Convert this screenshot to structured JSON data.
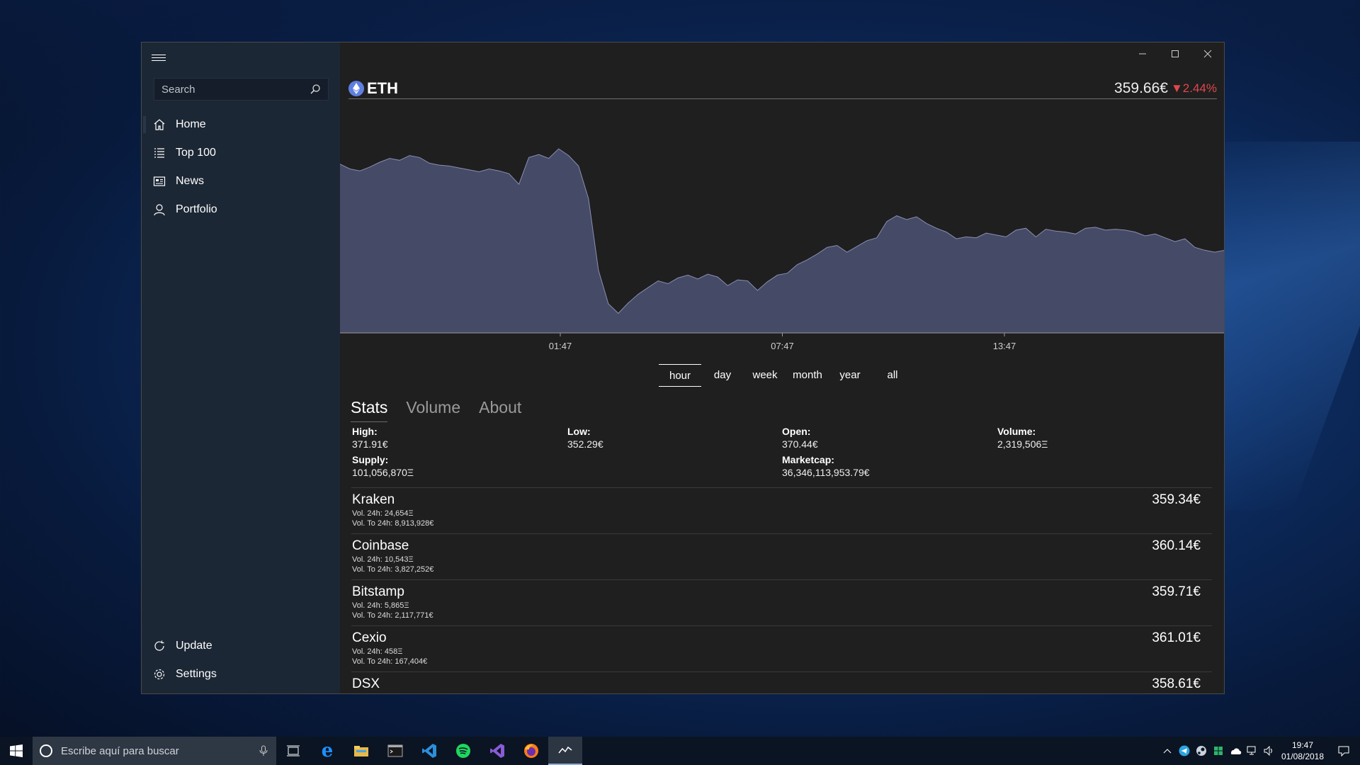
{
  "sidebar": {
    "search_placeholder": "Search",
    "items": [
      {
        "label": "Home"
      },
      {
        "label": "Top 100"
      },
      {
        "label": "News"
      },
      {
        "label": "Portfolio"
      }
    ],
    "bottom_items": [
      {
        "label": "Update"
      },
      {
        "label": "Settings"
      }
    ]
  },
  "coin": {
    "symbol": "ETH",
    "price": "359.66€",
    "change": "▼2.44%",
    "colors": {
      "negative": "#e0474c",
      "chart_fill": "#454a66",
      "chart_line": "#8a8fb3",
      "logo": "#5f7fe0"
    }
  },
  "chart_data": {
    "type": "area",
    "x_ticks": [
      "01:47",
      "07:47",
      "13:47"
    ],
    "y_min": 352.29,
    "y_max": 371.91,
    "series": [
      {
        "values": [
          368.6,
          368.1,
          367.9,
          368.3,
          368.8,
          369.2,
          369.0,
          369.5,
          369.3,
          368.7,
          368.5,
          368.4,
          368.2,
          368.0,
          367.8,
          368.1,
          367.9,
          367.6,
          366.5,
          369.3,
          369.6,
          369.2,
          370.2,
          369.5,
          368.4,
          365.0,
          357.5,
          354.0,
          353.0,
          354.1,
          355.0,
          355.7,
          356.4,
          356.1,
          356.7,
          357.0,
          356.6,
          357.1,
          356.8,
          355.9,
          356.5,
          356.4,
          355.4,
          356.3,
          357.0,
          357.2,
          358.1,
          358.6,
          359.2,
          359.9,
          360.1,
          359.4,
          360.0,
          360.6,
          360.9,
          362.6,
          363.2,
          362.8,
          363.1,
          362.4,
          361.9,
          361.5,
          360.8,
          361.0,
          360.9,
          361.4,
          361.2,
          361.0,
          361.7,
          361.9,
          361.0,
          361.8,
          361.6,
          361.5,
          361.3,
          361.9,
          362.0,
          361.7,
          361.8,
          361.7,
          361.5,
          361.1,
          361.3,
          360.9,
          360.5,
          360.8,
          359.9,
          359.6,
          359.4,
          359.6
        ]
      }
    ],
    "ylabel": "",
    "xlabel": ""
  },
  "ranges": [
    "hour",
    "day",
    "week",
    "month",
    "year",
    "all"
  ],
  "tabs": [
    "Stats",
    "Volume",
    "About"
  ],
  "stats": {
    "high": {
      "label": "High:",
      "value": "371.91€"
    },
    "low": {
      "label": "Low:",
      "value": "352.29€"
    },
    "open": {
      "label": "Open:",
      "value": "370.44€"
    },
    "volume": {
      "label": "Volume:",
      "value": "2,319,506Ξ"
    },
    "supply": {
      "label": "Supply:",
      "value": "101,056,870Ξ"
    },
    "marketcap": {
      "label": "Marketcap:",
      "value": "36,346,113,953.79€"
    }
  },
  "exchanges": [
    {
      "name": "Kraken",
      "vol": "Vol. 24h: 24,654Ξ",
      "volto": "Vol. To 24h: 8,913,928€",
      "price": "359.34€"
    },
    {
      "name": "Coinbase",
      "vol": "Vol. 24h: 10,543Ξ",
      "volto": "Vol. To 24h: 3,827,252€",
      "price": "360.14€"
    },
    {
      "name": "Bitstamp",
      "vol": "Vol. 24h: 5,865Ξ",
      "volto": "Vol. To 24h: 2,117,771€",
      "price": "359.71€"
    },
    {
      "name": "Cexio",
      "vol": "Vol. 24h: 458Ξ",
      "volto": "Vol. To 24h: 167,404€",
      "price": "361.01€"
    },
    {
      "name": "DSX",
      "vol": "",
      "volto": "",
      "price": "358.61€"
    }
  ],
  "taskbar": {
    "search_text": "Escribe aquí para buscar",
    "time": "19:47",
    "date": "01/08/2018"
  }
}
